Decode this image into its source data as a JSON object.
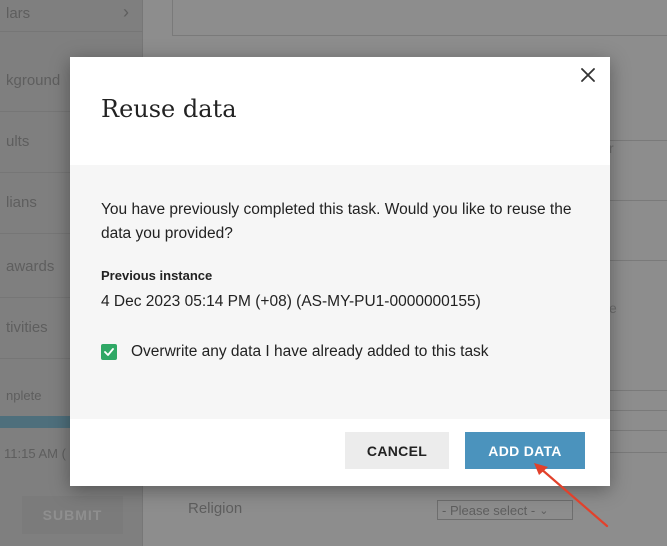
{
  "sidebar": {
    "items": [
      {
        "label": "lars"
      },
      {
        "label": "kground"
      },
      {
        "label": "ults"
      },
      {
        "label": "lians"
      },
      {
        "label": "awards"
      },
      {
        "label": "tivities"
      }
    ],
    "status_label": "nplete",
    "timestamp": "11:15 AM (",
    "submit_label": "SUBMIT"
  },
  "main": {
    "religion_label": "Religion",
    "religion_select": "- Please select -",
    "edge_letters": [
      "r",
      "e"
    ]
  },
  "modal": {
    "title": "Reuse data",
    "message": "You have previously completed this task. Would you like to reuse the data you provided?",
    "previous_instance_label": "Previous instance",
    "previous_instance_value": "4 Dec 2023 05:14 PM (+08) (AS-MY-PU1-0000000155)",
    "overwrite_label": "Overwrite any data I have already added to this task",
    "overwrite_checked": true,
    "cancel_label": "CANCEL",
    "add_label": "ADD DATA",
    "close_icon": "close-icon"
  },
  "colors": {
    "primary_button": "#4b93bd",
    "checkbox": "#2fa865",
    "annotation_arrow": "#e2412b"
  }
}
